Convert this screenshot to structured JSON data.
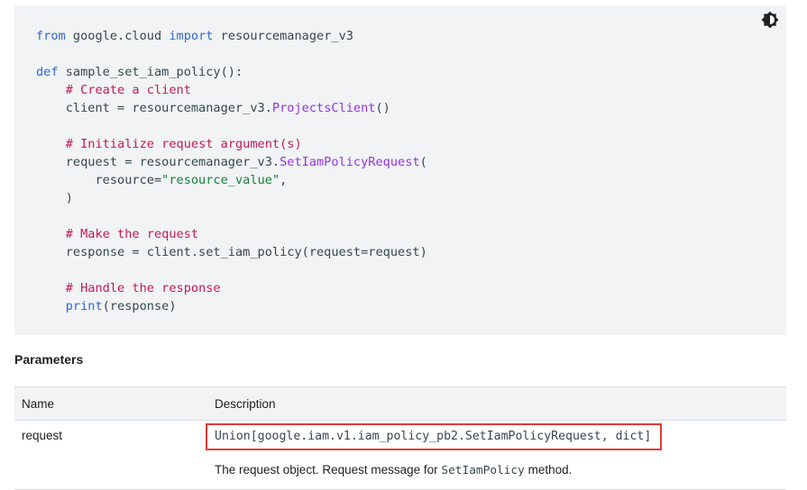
{
  "code_block": {
    "theme_toggle_icon": "brightness-icon",
    "lines": [
      [
        {
          "t": "kw",
          "v": "from"
        },
        {
          "t": "plain",
          "v": " google.cloud "
        },
        {
          "t": "kw",
          "v": "import"
        },
        {
          "t": "plain",
          "v": " resourcemanager_v3"
        }
      ],
      [],
      [
        {
          "t": "kw",
          "v": "def"
        },
        {
          "t": "plain",
          "v": " sample_set_iam_policy():"
        }
      ],
      [
        {
          "t": "plain",
          "v": "    "
        },
        {
          "t": "com",
          "v": "# Create a client"
        }
      ],
      [
        {
          "t": "plain",
          "v": "    client = resourcemanager_v3."
        },
        {
          "t": "cls",
          "v": "ProjectsClient"
        },
        {
          "t": "plain",
          "v": "()"
        }
      ],
      [],
      [
        {
          "t": "plain",
          "v": "    "
        },
        {
          "t": "com",
          "v": "# Initialize request argument(s)"
        }
      ],
      [
        {
          "t": "plain",
          "v": "    request = resourcemanager_v3."
        },
        {
          "t": "cls",
          "v": "SetIamPolicyRequest"
        },
        {
          "t": "plain",
          "v": "("
        }
      ],
      [
        {
          "t": "plain",
          "v": "        resource="
        },
        {
          "t": "str",
          "v": "\"resource_value\""
        },
        {
          "t": "plain",
          "v": ","
        }
      ],
      [
        {
          "t": "plain",
          "v": "    )"
        }
      ],
      [],
      [
        {
          "t": "plain",
          "v": "    "
        },
        {
          "t": "com",
          "v": "# Make the request"
        }
      ],
      [
        {
          "t": "plain",
          "v": "    response = client.set_iam_policy(request=request)"
        }
      ],
      [],
      [
        {
          "t": "plain",
          "v": "    "
        },
        {
          "t": "com",
          "v": "# Handle the response"
        }
      ],
      [
        {
          "t": "plain",
          "v": "    "
        },
        {
          "t": "kw",
          "v": "print"
        },
        {
          "t": "plain",
          "v": "(response)"
        }
      ]
    ]
  },
  "parameters": {
    "title": "Parameters",
    "headers": {
      "name": "Name",
      "description": "Description"
    },
    "rows": [
      {
        "name": "request",
        "type": "Union[google.iam.v1.iam_policy_pb2.SetIamPolicyRequest, dict]",
        "desc_before": "The request object. Request message for ",
        "desc_code": "SetIamPolicy",
        "desc_after": " method."
      }
    ]
  },
  "colors": {
    "code_bg": "#f1f3f4",
    "keyword": "#3367d6",
    "comment": "#c2185b",
    "class_name": "#9334e6",
    "string": "#188038",
    "highlight_border": "#e53935"
  }
}
